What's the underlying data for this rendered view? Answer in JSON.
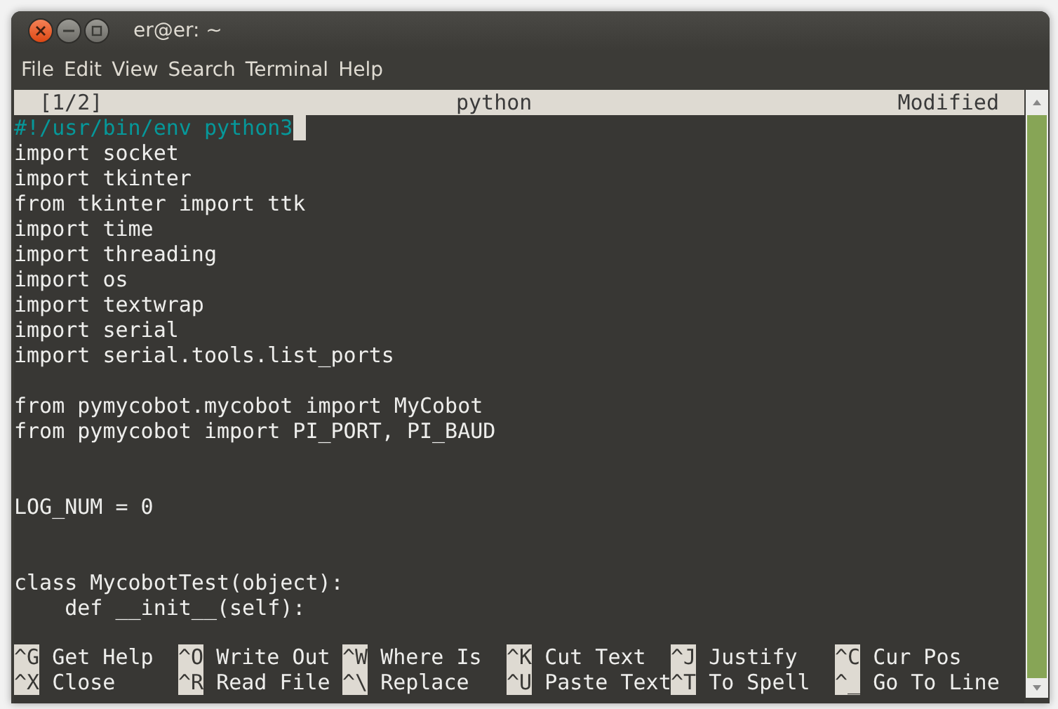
{
  "window": {
    "title": "er@er: ~"
  },
  "menu": [
    "File",
    "Edit",
    "View",
    "Search",
    "Terminal",
    "Help"
  ],
  "editor_header": {
    "buffer": "[1/2]",
    "filename": "python",
    "status": "Modified"
  },
  "lines": [
    {
      "kind": "comment",
      "text": "#!/usr/bin/env python3",
      "cursor": true
    },
    {
      "kind": "code",
      "text": "import socket",
      "cursor": false
    },
    {
      "kind": "code",
      "text": "import tkinter",
      "cursor": false
    },
    {
      "kind": "code",
      "text": "from tkinter import ttk",
      "cursor": false
    },
    {
      "kind": "code",
      "text": "import time",
      "cursor": false
    },
    {
      "kind": "code",
      "text": "import threading",
      "cursor": false
    },
    {
      "kind": "code",
      "text": "import os",
      "cursor": false
    },
    {
      "kind": "code",
      "text": "import textwrap",
      "cursor": false
    },
    {
      "kind": "code",
      "text": "import serial",
      "cursor": false
    },
    {
      "kind": "code",
      "text": "import serial.tools.list_ports",
      "cursor": false
    },
    {
      "kind": "blank"
    },
    {
      "kind": "code",
      "text": "from pymycobot.mycobot import MyCobot",
      "cursor": false
    },
    {
      "kind": "code",
      "text": "from pymycobot import PI_PORT, PI_BAUD",
      "cursor": false
    },
    {
      "kind": "blank"
    },
    {
      "kind": "blank"
    },
    {
      "kind": "code",
      "text": "LOG_NUM = 0",
      "cursor": false
    },
    {
      "kind": "blank"
    },
    {
      "kind": "blank"
    },
    {
      "kind": "code",
      "text": "class MycobotTest(object):",
      "cursor": false
    },
    {
      "kind": "code",
      "text": "    def __init__(self):",
      "cursor": false
    }
  ],
  "shortcuts": [
    {
      "key": "^G",
      "label": "Get Help"
    },
    {
      "key": "^O",
      "label": "Write Out"
    },
    {
      "key": "^W",
      "label": "Where Is"
    },
    {
      "key": "^K",
      "label": "Cut Text"
    },
    {
      "key": "^J",
      "label": "Justify"
    },
    {
      "key": "^C",
      "label": "Cur Pos"
    },
    {
      "key": "^X",
      "label": "Close"
    },
    {
      "key": "^R",
      "label": "Read File"
    },
    {
      "key": "^\\",
      "label": "Replace"
    },
    {
      "key": "^U",
      "label": "Paste Text"
    },
    {
      "key": "^T",
      "label": "To Spell"
    },
    {
      "key": "^_",
      "label": "Go To Line"
    }
  ]
}
